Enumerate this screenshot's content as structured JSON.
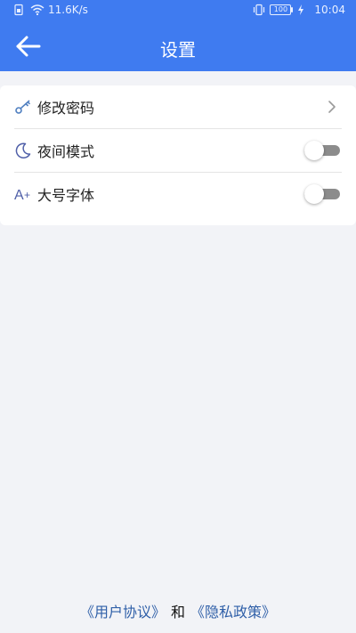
{
  "statusbar": {
    "network_speed": "11.6K/s",
    "battery_level": "100",
    "time": "10:04"
  },
  "header": {
    "title": "设置",
    "back_icon": "back-arrow-icon"
  },
  "settings": {
    "items": [
      {
        "label": "修改密码",
        "icon": "key-icon",
        "accessory": "chevron-right-icon"
      },
      {
        "label": "夜间模式",
        "icon": "moon-icon",
        "accessory": "toggle",
        "enabled": false
      },
      {
        "label": "大号字体",
        "icon": "font-size-icon",
        "accessory": "toggle",
        "enabled": false
      }
    ]
  },
  "footer": {
    "user_agreement": "《用户协议》",
    "and": "和",
    "privacy_policy": "《隐私政策》"
  },
  "colors": {
    "primary": "#3f7bf0",
    "icon_accent": "#4f7fc0",
    "link": "#2f5fa8",
    "background": "#f2f3f7"
  }
}
